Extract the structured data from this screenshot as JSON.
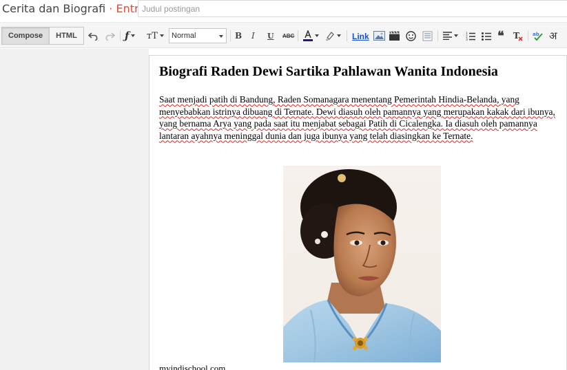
{
  "header": {
    "blog_name": "Cerita dan Biografi",
    "separator": " · ",
    "mode": "Entri",
    "title_placeholder": "Judul postingan",
    "title_value": ""
  },
  "toolbar": {
    "compose_label": "Compose",
    "html_label": "HTML",
    "format_value": "Normal",
    "link_label": "Link",
    "input_tools_label": "अ"
  },
  "post": {
    "heading": "Biografi Raden Dewi Sartika Pahlawan Wanita Indonesia",
    "paragraph": "Saat menjadi patih di Bandung, Raden Somanagara menentang Pemerintah Hindia-Belanda, yang menyebabkan istrinya dibuang di Ternate. Dewi diasuh oleh pamannya yang merupakan kakak dari ibunya, yang bernama Arya yang pada saat itu menjabat sebagai Patih di Cicalengka. Ia diasuh oleh pamannya lantaran ayahnya meninggal dunia dan juga ibunya yang telah diasingkan ke Ternate.",
    "image_caption": "myindischool.com"
  },
  "colors": {
    "accent": "#dd4b39",
    "link": "#1155cc",
    "spellcheck": "#e0211b"
  }
}
